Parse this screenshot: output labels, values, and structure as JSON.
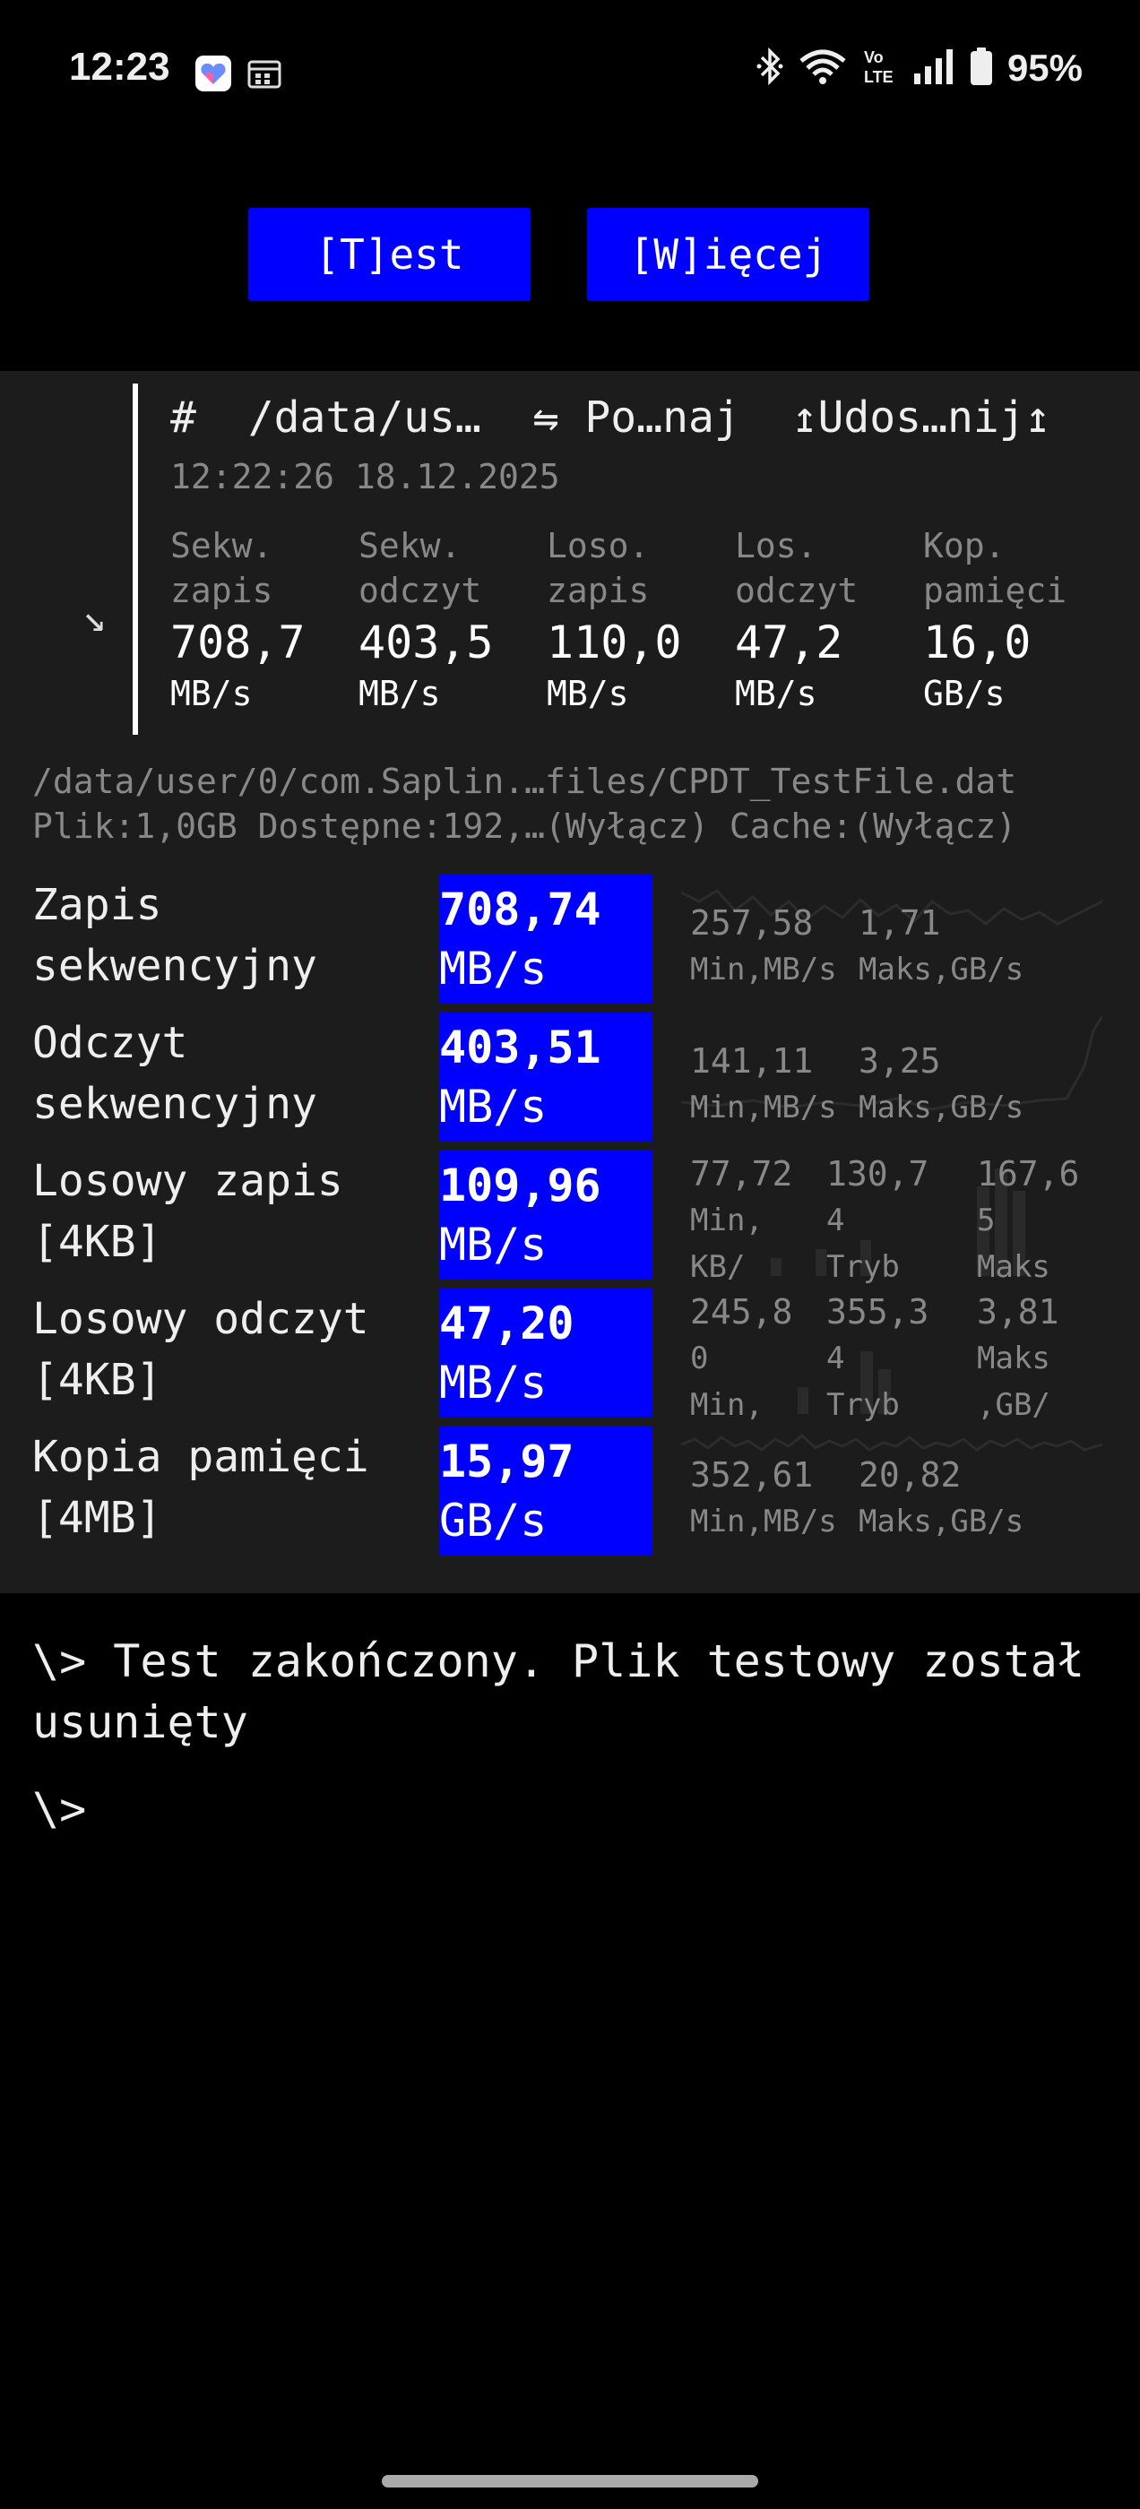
{
  "status_bar": {
    "time": "12:23",
    "battery": "95%",
    "icons": [
      "health-app-icon",
      "calendar-icon",
      "bluetooth-icon",
      "wifi-icon",
      "volte-icon",
      "signal-icon",
      "battery-icon"
    ]
  },
  "buttons": {
    "test": "[T]est",
    "more": "[W]ięcej"
  },
  "summary": {
    "header_hash": "#",
    "path": "/data/us…",
    "compare": "⇋ Po…naj",
    "share": "↥Udos…nij↥",
    "timestamp": "12:22:26 18.12.2025",
    "metrics": [
      {
        "label1": "Sekw.",
        "label2": "zapis",
        "value": "708,7",
        "unit": "MB/s"
      },
      {
        "label1": "Sekw.",
        "label2": "odczyt",
        "value": "403,5",
        "unit": "MB/s"
      },
      {
        "label1": "Loso.",
        "label2": "zapis",
        "value": "110,0",
        "unit": "MB/s"
      },
      {
        "label1": "Los.",
        "label2": "odczyt",
        "value": "47,2",
        "unit": "MB/s"
      },
      {
        "label1": "Kop.",
        "label2": "pamięci",
        "value": "16,0",
        "unit": "GB/s"
      }
    ]
  },
  "file": {
    "path": "/data/user/0/com.Saplin.…files/CPDT_TestFile.dat",
    "info": "Plik:1,0GB Dostępne:192,…(Wyłącz) Cache:(Wyłącz)"
  },
  "results": [
    {
      "name1": "Zapis",
      "name2": "sekwencyjny",
      "value": "708,74",
      "unit": "MB/s",
      "stats": [
        {
          "val": "257,58",
          "sub": "Min,MB/s"
        },
        {
          "val": "1,71",
          "sub": "Maks,GB/s"
        }
      ]
    },
    {
      "name1": "Odczyt",
      "name2": "sekwencyjny",
      "value": "403,51",
      "unit": "MB/s",
      "stats": [
        {
          "val": "141,11",
          "sub": "Min,MB/s"
        },
        {
          "val": "3,25",
          "sub": "Maks,GB/s"
        }
      ]
    },
    {
      "name1": "Losowy zapis",
      "name2": "[4KB]",
      "value": "109,96",
      "unit": "MB/s",
      "stats": [
        {
          "l1": "77,72",
          "l2": "Min,",
          "l3": "KB/"
        },
        {
          "l1": "130,7",
          "l2": "4",
          "l3": "Tryb"
        },
        {
          "l1": "167,6",
          "l2": "5",
          "l3": "Maks"
        }
      ]
    },
    {
      "name1": "Losowy odczyt",
      "name2": "[4KB]",
      "value": "47,20",
      "unit": "MB/s",
      "stats": [
        {
          "l1": "245,8",
          "l2": "0",
          "l3": "Min,"
        },
        {
          "l1": "355,3",
          "l2": "4",
          "l3": "Tryb"
        },
        {
          "l1": "3,81",
          "l2": "Maks",
          "l3": ",GB/"
        }
      ]
    },
    {
      "name1": "Kopia pamięci",
      "name2": "[4MB]",
      "value": "15,97",
      "unit": "GB/s",
      "stats": [
        {
          "val": "352,61",
          "sub": "Min,MB/s"
        },
        {
          "val": "20,82",
          "sub": "Maks,GB/s"
        }
      ]
    }
  ],
  "console": {
    "message": "\\> Test zakończony. Plik testowy został usunięty",
    "prompt": "\\>"
  }
}
